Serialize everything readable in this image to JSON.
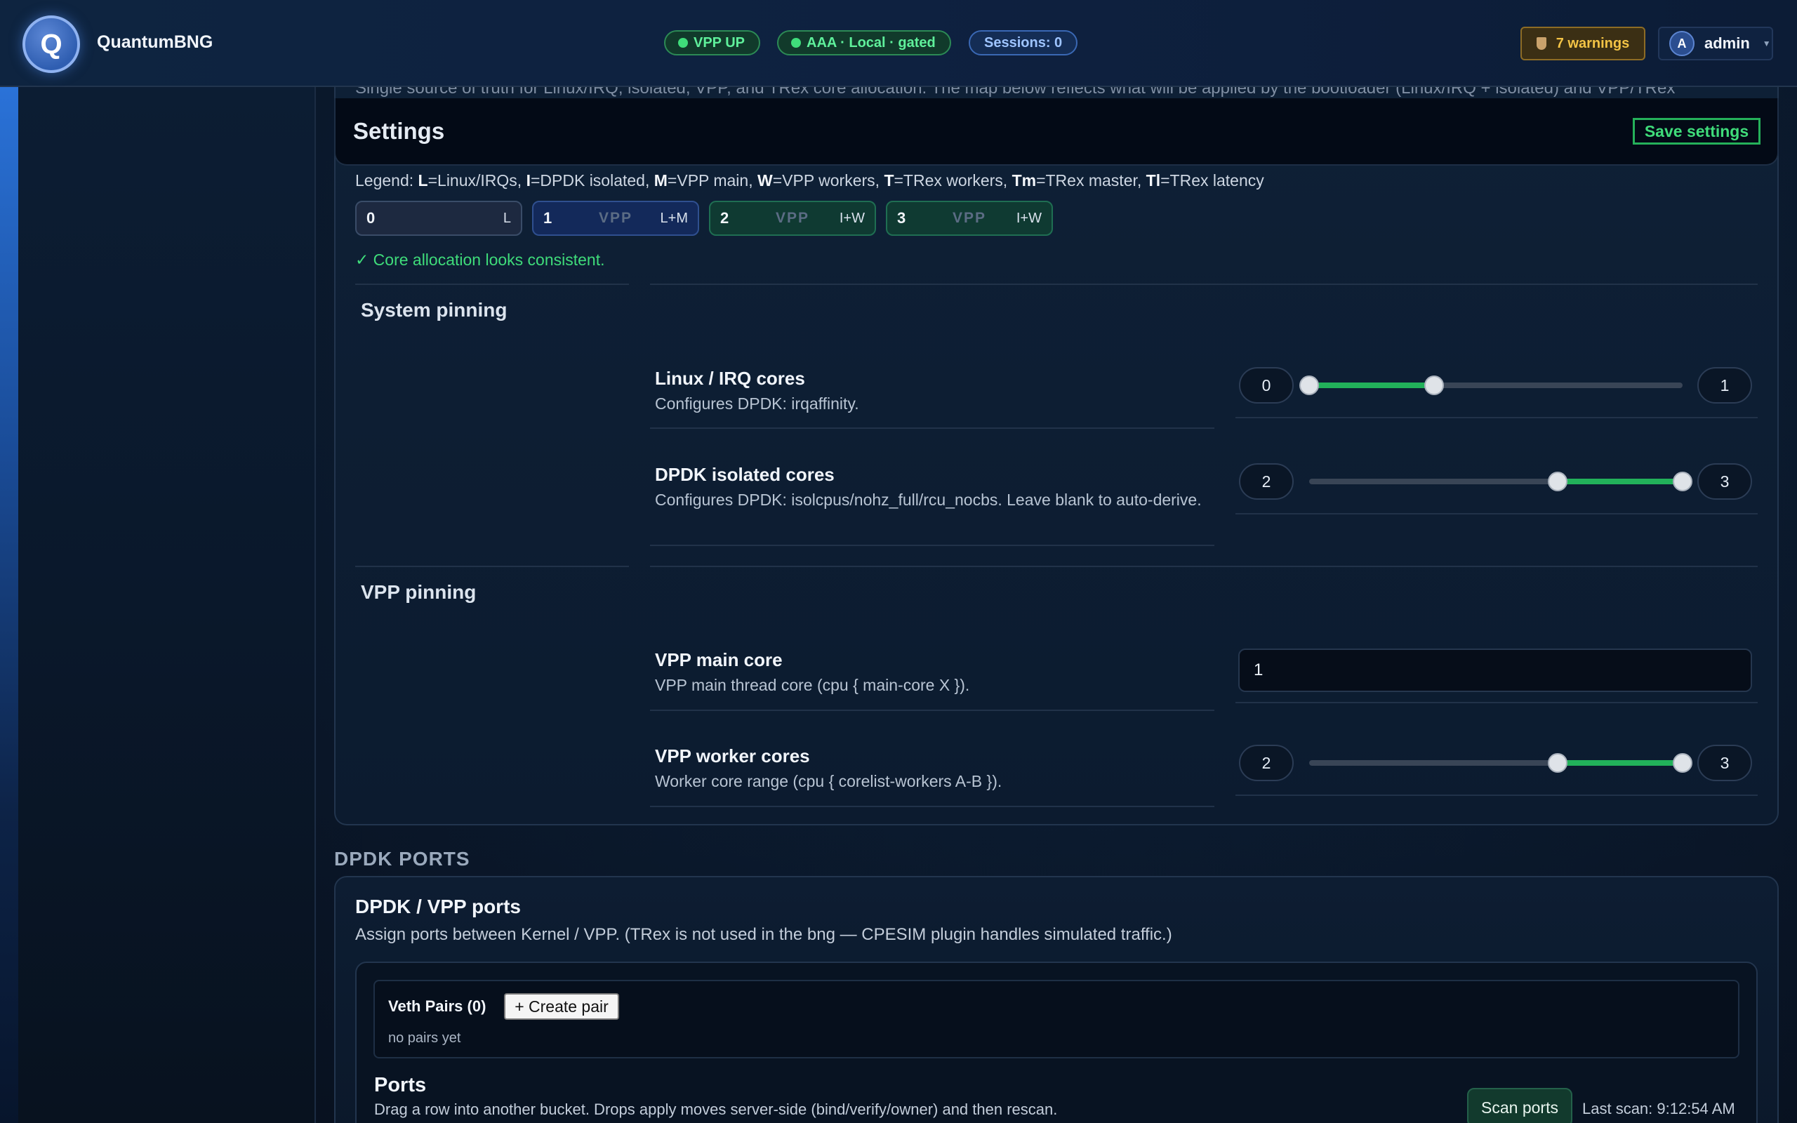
{
  "app": {
    "name": "QuantumBNG",
    "logo_letter": "Q"
  },
  "status": {
    "vpp": "VPP UP",
    "aaa": "AAA · Local · gated",
    "sessions": "Sessions: 0",
    "warnings": "7 warnings",
    "user_initial": "A",
    "user_name": "admin"
  },
  "intro": "Single source of truth for Linux/IRQ, isolated, VPP, and TRex core allocation. The map below reflects what will be applied by the bootloader (Linux/IRQ + isolated) and VPP/TRex",
  "settings": {
    "title": "Settings",
    "save_label": "Save settings",
    "legend": {
      "prefix": "Legend: ",
      "items": [
        {
          "key": "L",
          "text": "=Linux/IRQs, "
        },
        {
          "key": "I",
          "text": "=DPDK isolated, "
        },
        {
          "key": "M",
          "text": "=VPP main, "
        },
        {
          "key": "W",
          "text": "=VPP workers, "
        },
        {
          "key": "T",
          "text": "=TRex workers, "
        },
        {
          "key": "Tm",
          "text": "=TRex master, "
        },
        {
          "key": "Tl",
          "text": "=TRex latency"
        }
      ]
    },
    "cores": [
      {
        "num": "0",
        "mid": "",
        "role": "L"
      },
      {
        "num": "1",
        "mid": "VPP",
        "role": "L+M"
      },
      {
        "num": "2",
        "mid": "VPP",
        "role": "I+W"
      },
      {
        "num": "3",
        "mid": "VPP",
        "role": "I+W"
      }
    ],
    "consistent_msg": "✓ Core allocation looks consistent.",
    "system_pinning": {
      "title": "System pinning",
      "linux_irq": {
        "label": "Linux / IRQ cores",
        "desc": "Configures DPDK: irqaffinity.",
        "min": "0",
        "max": "1"
      },
      "isolated": {
        "label": "DPDK isolated cores",
        "desc": "Configures DPDK: isolcpus/nohz_full/rcu_nocbs. Leave blank to auto-derive.",
        "min": "2",
        "max": "3"
      }
    },
    "vpp_pinning": {
      "title": "VPP pinning",
      "main_core": {
        "label": "VPP main core",
        "desc": "VPP main thread core (cpu { main-core X }).",
        "value": "1"
      },
      "workers": {
        "label": "VPP worker cores",
        "desc": "Worker core range (cpu { corelist-workers A-B }).",
        "min": "2",
        "max": "3"
      }
    }
  },
  "dpdk_ports": {
    "heading": "DPDK PORTS",
    "title": "DPDK / VPP ports",
    "desc": "Assign ports between Kernel / VPP. (TRex is not used in the bng — CPESIM plugin handles simulated traffic.)",
    "veth_title": "Veth Pairs (0)",
    "create_label": "+ Create pair",
    "no_pairs": "no pairs yet",
    "ports_title": "Ports",
    "ports_desc": "Drag a row into another bucket. Drops apply moves server-side (bind/verify/owner) and then rescan.",
    "scan_label": "Scan ports",
    "last_scan": "Last scan: 9:12:54 AM"
  },
  "colors": {
    "accent_green": "#3fdc7a",
    "warning": "#f3c345",
    "brand_blue": "#2f5eb1"
  }
}
